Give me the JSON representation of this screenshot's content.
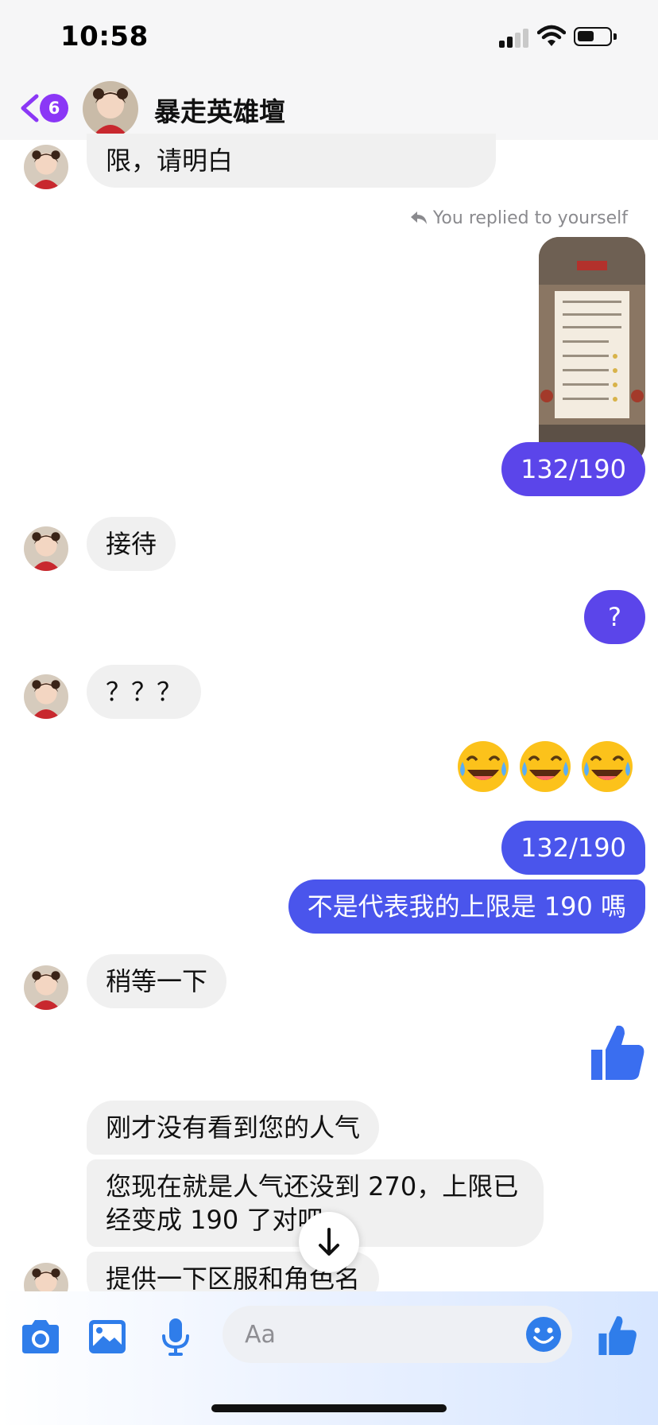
{
  "status_bar": {
    "time": "10:58",
    "signal_bars": 2
  },
  "header": {
    "back_badge_count": "6",
    "title": "暴走英雄壇"
  },
  "messages": {
    "m1_partial": "限，请明白",
    "reply_note": "You replied to yourself",
    "m2_out": "132/190",
    "m3_in": "接待",
    "m4_out": "?",
    "m5_in": "？？？",
    "m6_emoji": [
      "😂",
      "😂",
      "😂"
    ],
    "m7_out": "132/190",
    "m8_out": "不是代表我的上限是 190 嗎",
    "m9_in": "稍等一下",
    "m10_in": "刚才没有看到您的人气",
    "m11_in_line1": "您现在就是人气还没到 270，上限已",
    "m11_in_line2": "经变成 190 了对吧",
    "m12_in": "提供一下区服和角色名"
  },
  "composer": {
    "placeholder": "Aa"
  },
  "colors": {
    "accent_purple": "#8b37f6",
    "outgoing_bubble": "#5b45ea",
    "incoming_bubble": "#f0f0f0",
    "icon_blue": "#2f7dea"
  },
  "icons": [
    "chevron-left-icon",
    "camera-icon",
    "image-icon",
    "microphone-icon",
    "smiley-icon",
    "thumbs-up-icon",
    "arrow-down-icon"
  ]
}
